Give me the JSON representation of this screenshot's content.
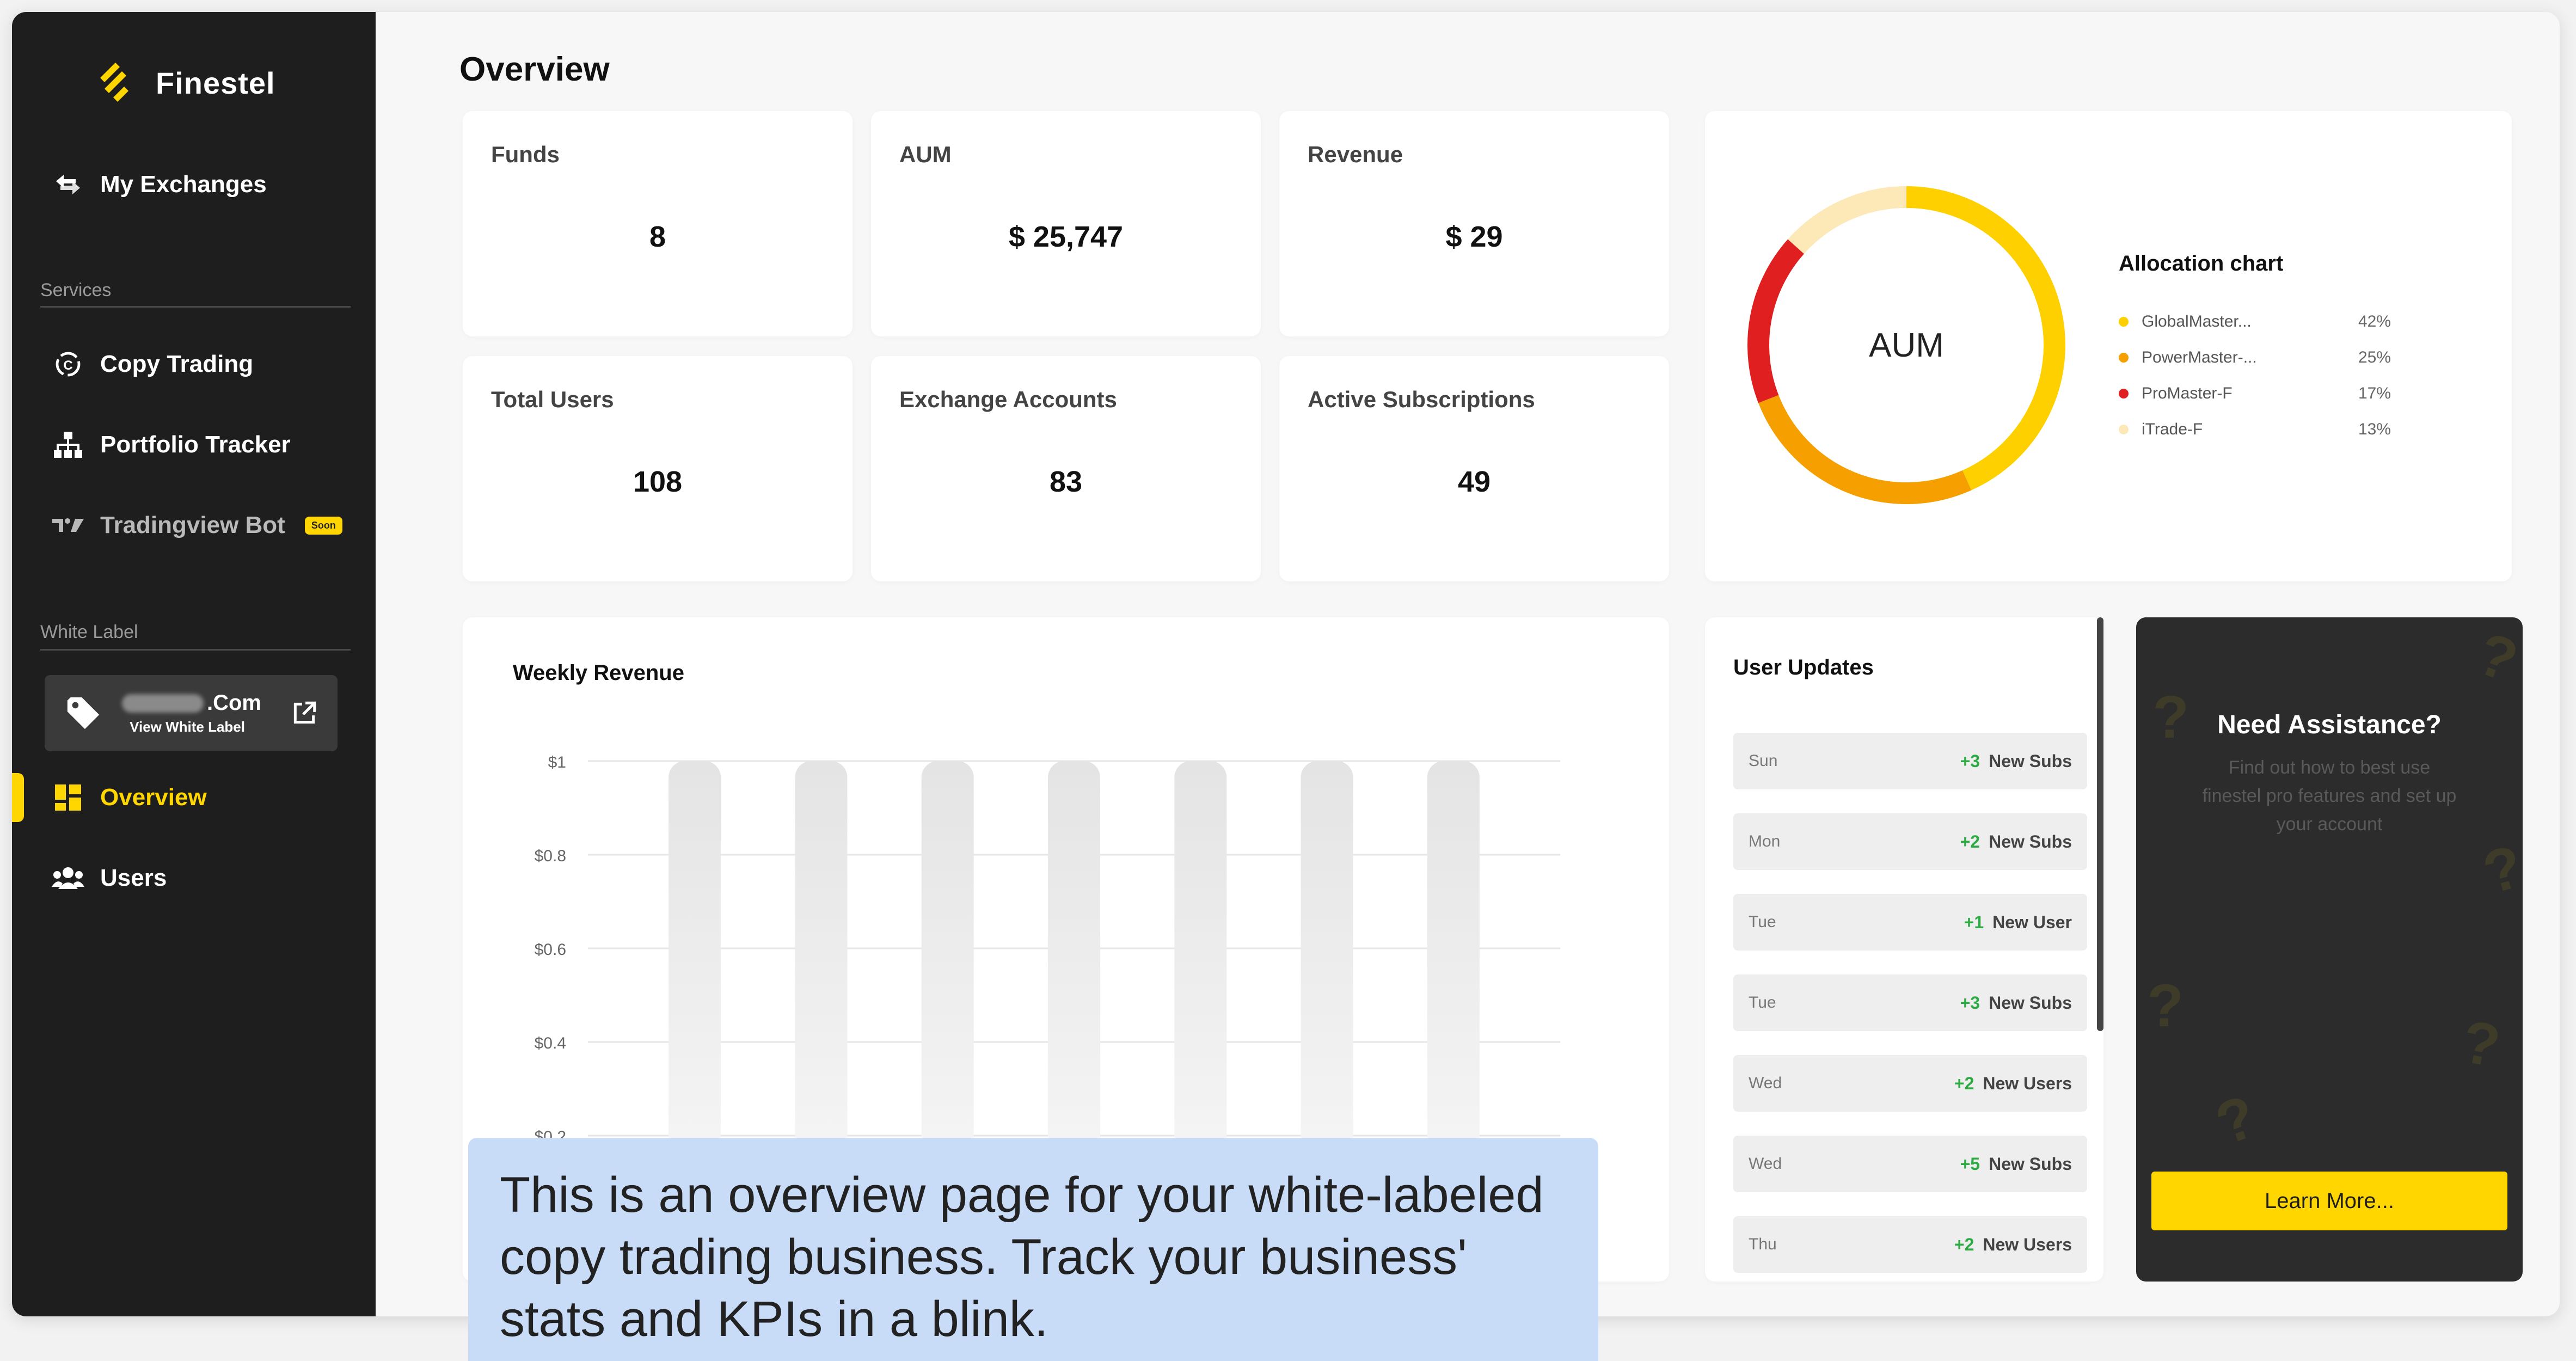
{
  "app": {
    "brand": "Finestel"
  },
  "sidebar": {
    "my_exchanges": "My Exchanges",
    "services_label": "Services",
    "copy_trading": "Copy Trading",
    "portfolio_tracker": "Portfolio Tracker",
    "tradingview_bot": "Tradingview Bot",
    "soon_badge": "Soon",
    "white_label_label": "White Label",
    "white_label_domain": ".Com",
    "view_white_label": "View White Label",
    "overview": "Overview",
    "users": "Users"
  },
  "page": {
    "title": "Overview"
  },
  "stats": [
    {
      "label": "Funds",
      "value": "8"
    },
    {
      "label": "AUM",
      "value": "$ 25,747"
    },
    {
      "label": "Revenue",
      "value": "$ 29"
    },
    {
      "label": "Total Users",
      "value": "108"
    },
    {
      "label": "Exchange Accounts",
      "value": "83"
    },
    {
      "label": "Active Subscriptions",
      "value": "49"
    }
  ],
  "allocation": {
    "center_label": "AUM",
    "title": "Allocation chart",
    "items": [
      {
        "name": "GlobalMaster...",
        "pct": "42%",
        "value": 42,
        "color": "#ffd000"
      },
      {
        "name": "PowerMaster-...",
        "pct": "25%",
        "value": 25,
        "color": "#f5a000"
      },
      {
        "name": "ProMaster-F",
        "pct": "17%",
        "value": 17,
        "color": "#e02020"
      },
      {
        "name": "iTrade-F",
        "pct": "13%",
        "value": 13,
        "color": "#fde9b8"
      }
    ]
  },
  "chart_data": {
    "type": "bar",
    "title": "Weekly Revenue",
    "xlabel": "",
    "ylabel": "",
    "y_ticks": [
      "$1",
      "$0.8",
      "$0.6",
      "$0.4",
      "$0.2"
    ],
    "ylim": [
      0,
      1
    ],
    "grid": true,
    "series": [
      {
        "values": [
          0,
          0,
          0,
          0,
          0,
          0,
          0
        ]
      }
    ]
  },
  "user_updates": {
    "title": "User Updates",
    "items": [
      {
        "day": "Sun",
        "change": "+3",
        "text": "New Subs"
      },
      {
        "day": "Mon",
        "change": "+2",
        "text": "New Subs"
      },
      {
        "day": "Tue",
        "change": "+1",
        "text": "New User"
      },
      {
        "day": "Tue",
        "change": "+3",
        "text": "New Subs"
      },
      {
        "day": "Wed",
        "change": "+2",
        "text": "New Users"
      },
      {
        "day": "Wed",
        "change": "+5",
        "text": "New Subs"
      },
      {
        "day": "Thu",
        "change": "+2",
        "text": "New Users"
      }
    ]
  },
  "assistance": {
    "title": "Need Assistance?",
    "description": "Find out how to best use finestel pro features and set up your account",
    "button": "Learn More..."
  },
  "caption": {
    "text": "This is an overview page for your white-labeled copy trading business. Track your business' stats and KPIs in a blink."
  },
  "colors": {
    "accent": "#ffd600",
    "sidebar_bg": "#1e1e1e",
    "positive": "#2eaa45"
  }
}
